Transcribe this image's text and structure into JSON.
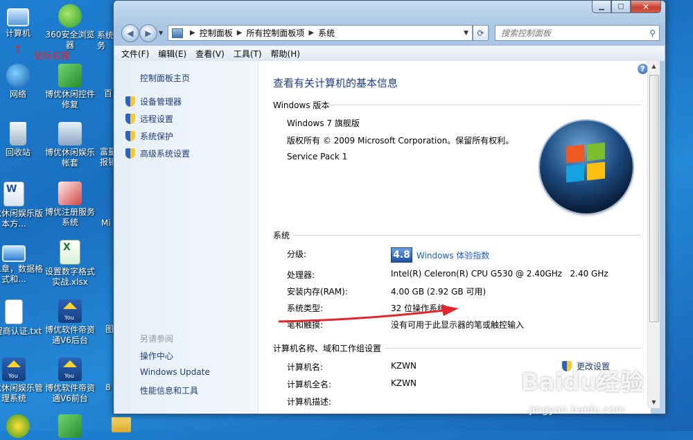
{
  "desktop": {
    "icons": [
      {
        "label": "计算机",
        "icon": "computer-icon"
      },
      {
        "label": "360安全浏览器",
        "icon": "browser-360-icon"
      },
      {
        "label": "网络",
        "icon": "network-icon"
      },
      {
        "label": "博优休闲控件修复",
        "icon": "repair-tool-icon"
      },
      {
        "label": "回收站",
        "icon": "recycle-bin-icon"
      },
      {
        "label": "博优休闲娱乐帐套",
        "icon": "calculator-icon"
      },
      {
        "label": "博优休闲娱乐版本方...",
        "icon": "word-doc-icon"
      },
      {
        "label": "博优注册服务系统",
        "icon": "registry-icon"
      },
      {
        "label": "第二章，数据格式和...",
        "icon": "monitor-icon"
      },
      {
        "label": "设置数字格式实战.xlsx",
        "icon": "excel-icon"
      },
      {
        "label": "工程商认证.txt",
        "icon": "text-doc-icon"
      },
      {
        "label": "博优软件帝资通V6后台",
        "icon": "boyou-you-icon"
      },
      {
        "label": "博优休闲娱乐管理系统",
        "icon": "boyou-you-icon"
      },
      {
        "label": "博优软件帝资通V6前台",
        "icon": "boyou-you-icon"
      }
    ],
    "partial_labels": [
      "系统",
      "务",
      "百",
      "富量",
      "报销",
      "Mi",
      "图",
      "8"
    ],
    "annotation": "鼠标右键",
    "annotation_arrow": "↑"
  },
  "window": {
    "address": {
      "segments": [
        "控制面板",
        "所有控制面板项",
        "系统"
      ]
    },
    "search_placeholder": "搜索控制面板",
    "menu": [
      "文件(F)",
      "编辑(E)",
      "查看(V)",
      "工具(T)",
      "帮助(H)"
    ],
    "side": {
      "home": "控制面板主页",
      "links": [
        "设备管理器",
        "远程设置",
        "系统保护",
        "高级系统设置"
      ],
      "see_also_title": "另请参阅",
      "see_also": [
        "操作中心",
        "Windows Update",
        "性能信息和工具"
      ]
    },
    "main": {
      "title": "查看有关计算机的基本信息",
      "edition_section": "Windows 版本",
      "edition": "Windows 7 旗舰版",
      "copyright": "版权所有 © 2009 Microsoft Corporation。保留所有权利。",
      "service_pack": "Service Pack 1",
      "system_section": "系统",
      "rating_label": "分级:",
      "rating_score": "4.8",
      "rating_link": "Windows 体验指数",
      "cpu_label": "处理器:",
      "cpu_value": "Intel(R) Celeron(R) CPU G530 @ 2.40GHz   2.40 GHz",
      "ram_label": "安装内存(RAM):",
      "ram_value": "4.00 GB (2.92 GB 可用)",
      "type_label": "系统类型:",
      "type_value": "32 位操作系统",
      "pen_label": "笔和触摸:",
      "pen_value": "没有可用于此显示器的笔或触控输入",
      "name_section": "计算机名称、域和工作组设置",
      "cname_label": "计算机名:",
      "cname_value": "KZWN",
      "cfull_label": "计算机全名:",
      "cfull_value": "KZWN",
      "cdesc_label": "计算机描述:",
      "change_link": "更改设置"
    }
  },
  "watermark": {
    "text": "Baidu经验",
    "url": "jingyan.baidu.com"
  },
  "colors": {
    "link": "#1e3c78",
    "title": "#1e3c8c",
    "annotation": "#e0262a"
  }
}
